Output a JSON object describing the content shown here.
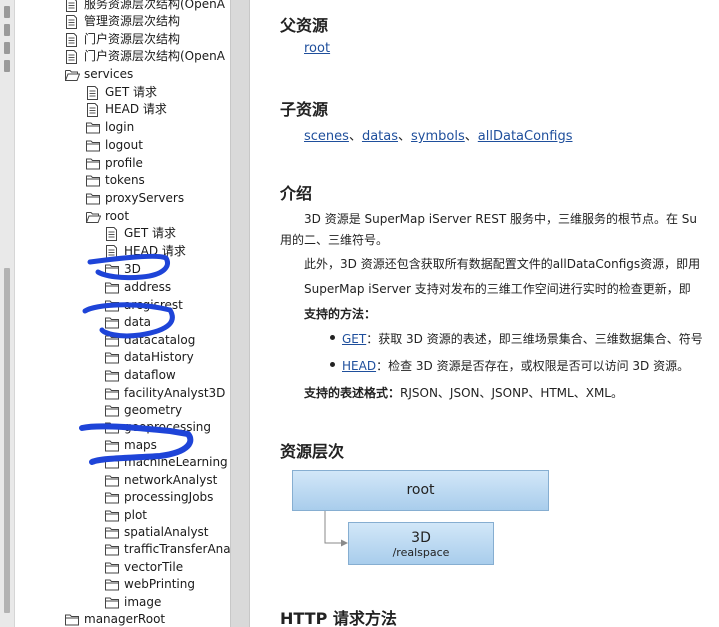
{
  "sidebar": {
    "tree": [
      {
        "label": "服务资源层次结构(OpenA",
        "icon": "doc-icon"
      },
      {
        "label": "管理资源层次结构",
        "icon": "doc-icon"
      },
      {
        "label": "门户资源层次结构",
        "icon": "doc-icon"
      },
      {
        "label": "门户资源层次结构(OpenA",
        "icon": "doc-icon"
      },
      {
        "label": "services",
        "icon": "folder-open-icon"
      },
      {
        "label": "GET 请求",
        "icon": "doc-icon"
      },
      {
        "label": "HEAD 请求",
        "icon": "doc-icon"
      },
      {
        "label": "login",
        "icon": "folder-icon"
      },
      {
        "label": "logout",
        "icon": "folder-icon"
      },
      {
        "label": "profile",
        "icon": "folder-icon"
      },
      {
        "label": "tokens",
        "icon": "folder-icon"
      },
      {
        "label": "proxyServers",
        "icon": "folder-icon"
      },
      {
        "label": "root",
        "icon": "folder-open-icon"
      },
      {
        "label": "GET 请求",
        "icon": "doc-icon"
      },
      {
        "label": "HEAD 请求",
        "icon": "doc-icon"
      },
      {
        "label": "3D",
        "icon": "folder-icon"
      },
      {
        "label": "address",
        "icon": "folder-icon"
      },
      {
        "label": "arcgisrest",
        "icon": "folder-icon"
      },
      {
        "label": "data",
        "icon": "folder-icon"
      },
      {
        "label": "datacatalog",
        "icon": "folder-icon"
      },
      {
        "label": "dataHistory",
        "icon": "folder-icon"
      },
      {
        "label": "dataflow",
        "icon": "folder-icon"
      },
      {
        "label": "facilityAnalyst3D",
        "icon": "folder-icon"
      },
      {
        "label": "geometry",
        "icon": "folder-icon"
      },
      {
        "label": "geoprocessing",
        "icon": "folder-icon"
      },
      {
        "label": "maps",
        "icon": "folder-icon"
      },
      {
        "label": "machineLearning",
        "icon": "folder-icon"
      },
      {
        "label": "networkAnalyst",
        "icon": "folder-icon"
      },
      {
        "label": "processingJobs",
        "icon": "folder-icon"
      },
      {
        "label": "plot",
        "icon": "folder-icon"
      },
      {
        "label": "spatialAnalyst",
        "icon": "folder-icon"
      },
      {
        "label": "trafficTransferAnal",
        "icon": "folder-icon"
      },
      {
        "label": "vectorTile",
        "icon": "folder-icon"
      },
      {
        "label": "webPrinting",
        "icon": "folder-icon"
      },
      {
        "label": "image",
        "icon": "folder-icon"
      },
      {
        "label": "managerRoot",
        "icon": "folder-icon"
      }
    ]
  },
  "content": {
    "parent": {
      "title": "父资源",
      "link": "root"
    },
    "children": {
      "title": "子资源",
      "links": [
        "scenes",
        "datas",
        "symbols",
        "allDataConfigs"
      ],
      "separator": "、"
    },
    "intro": {
      "title": "介绍",
      "p1_line1": "3D 资源是 SuperMap iServer REST 服务中，三维服务的根节点。在 Su",
      "p1_line2": "用的二、三维符号。",
      "p2": "此外，3D 资源还包含获取所有数据配置文件的allDataConfigs资源，即用",
      "p3": "SuperMap iServer 支持对发布的三维工作空间进行实时的检查更新，即",
      "methods_label": "支持的方法：",
      "get_link": "GET",
      "get_desc": "：获取 3D 资源的表述，即三维场景集合、三维数据集合、符号",
      "head_link": "HEAD",
      "head_desc": "：检查 3D 资源是否存在，或权限是否可以访问 3D 资源。",
      "formats_label": "支持的表述格式：",
      "formats_value": "RJSON、JSON、JSONP、HTML、XML。"
    },
    "hierarchy": {
      "title": "资源层次",
      "root_label": "root",
      "child_label": "3D",
      "child_sublabel": "/realspace"
    },
    "http": {
      "title": "HTTP 请求方法"
    }
  },
  "colors": {
    "link": "#1f4f9c",
    "annotation": "#1e44d8",
    "diagram_fill": "#bcd9f1",
    "diagram_border": "#86aed1"
  }
}
